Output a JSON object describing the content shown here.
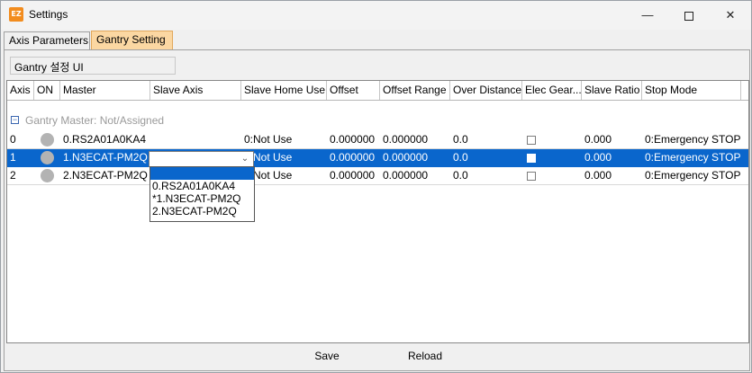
{
  "window": {
    "title": "Settings",
    "icon_text": "EZ",
    "accent": "#0a66cc"
  },
  "tabs": [
    {
      "label": "Axis Parameters",
      "active": false
    },
    {
      "label": "Gantry Setting",
      "active": true
    }
  ],
  "panel": {
    "ui_label": "Gantry 설정 UI"
  },
  "grid": {
    "columns": [
      "Axis",
      "ON",
      "Master",
      "Slave Axis",
      "Slave Home Use",
      "Offset",
      "Offset Range",
      "Over Distance",
      "Elec Gear...",
      "Slave Ratio",
      "Stop Mode"
    ],
    "group": {
      "expander": "−",
      "label": "Gantry Master: Not/Assigned"
    },
    "rows": [
      {
        "axis": "0",
        "master": "0.RS2A01A0KA4",
        "slave_axis": "",
        "slave_home_use": "0:Not Use",
        "offset": "0.000000",
        "offset_range": "0.000000",
        "over_distance": "0.0",
        "elec_gear": false,
        "slave_ratio": "0.000",
        "stop_mode": "0:Emergency STOP",
        "selected": false
      },
      {
        "axis": "1",
        "master": "1.N3ECAT-PM2Q",
        "slave_axis": "",
        "slave_home_use": "Not Use",
        "offset": "0.000000",
        "offset_range": "0.000000",
        "over_distance": "0.0",
        "elec_gear": false,
        "slave_ratio": "0.000",
        "stop_mode": "0:Emergency STOP",
        "selected": true
      },
      {
        "axis": "2",
        "master": "2.N3ECAT-PM2Q",
        "slave_axis": "",
        "slave_home_use": "Not Use",
        "offset": "0.000000",
        "offset_range": "0.000000",
        "over_distance": "0.0",
        "elec_gear": false,
        "slave_ratio": "0.000",
        "stop_mode": "0:Emergency STOP",
        "selected": false
      }
    ]
  },
  "slave_axis_dropdown": {
    "value": "",
    "options": [
      "",
      "0.RS2A01A0KA4",
      "*1.N3ECAT-PM2Q",
      "2.N3ECAT-PM2Q"
    ],
    "highlighted_index": 0
  },
  "buttons": {
    "save": "Save",
    "reload": "Reload"
  }
}
